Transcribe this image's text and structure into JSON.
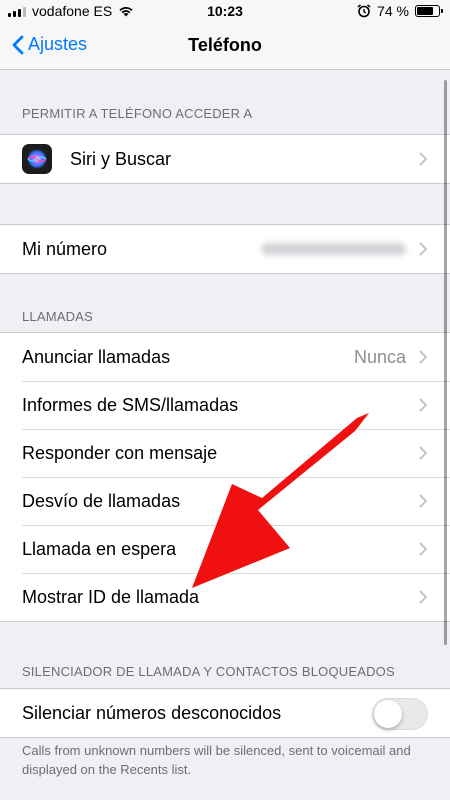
{
  "status_bar": {
    "carrier": "vodafone ES",
    "time": "10:23",
    "battery_percent": "74 %",
    "battery_level": 0.74
  },
  "nav": {
    "back_label": "Ajustes",
    "title": "Teléfono"
  },
  "sections": {
    "allow_header": "PERMITIR A TELÉFONO ACCEDER A",
    "siri_label": "Siri y Buscar",
    "my_number_label": "Mi número",
    "calls_header": "LLAMADAS",
    "calls_items": [
      {
        "label": "Anunciar llamadas",
        "value": "Nunca"
      },
      {
        "label": "Informes de SMS/llamadas"
      },
      {
        "label": "Responder con mensaje"
      },
      {
        "label": "Desvío de llamadas"
      },
      {
        "label": "Llamada en espera"
      },
      {
        "label": "Mostrar ID de llamada"
      }
    ],
    "silence_header": "SILENCIADOR DE LLAMADA Y CONTACTOS BLOQUEADOS",
    "silence_label": "Silenciar números desconocidos",
    "silence_enabled": false,
    "silence_footer": "Calls from unknown numbers will be silenced, sent to voicemail and displayed on the Recents list."
  },
  "colors": {
    "accent": "#007aff",
    "annotation_arrow": "#f01010"
  },
  "icons": [
    "signal-icon",
    "wifi-icon",
    "alarm-icon",
    "battery-icon",
    "back-chevron-icon",
    "siri-icon",
    "chevron-right-icon",
    "red-arrow-annotation"
  ]
}
